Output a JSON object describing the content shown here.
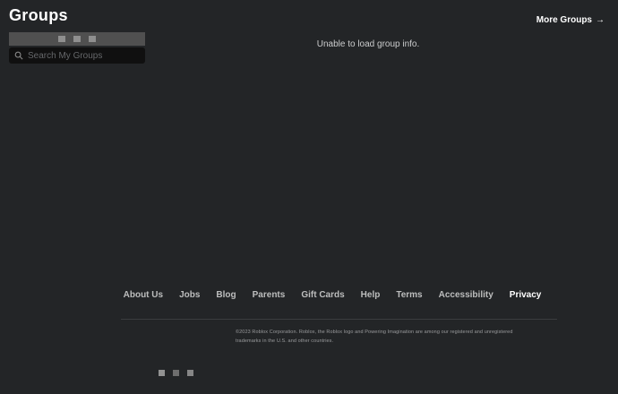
{
  "colors": {
    "bg": "#232527",
    "text-primary": "#ffffff",
    "text-secondary": "#bdbebe",
    "text-muted": "#9a9b9d",
    "tabstrip-bg": "#505050",
    "placeholder-square": "#8f8f8f",
    "searchbox-bg": "#101010",
    "search-placeholder": "#65676a",
    "divider": "#3b3d3f",
    "message": "#cbcccd",
    "social-sq-1": "#929292",
    "social-sq-2": "#6e6e6e",
    "social-sq-3": "#868686"
  },
  "header": {
    "title": "Groups",
    "more_groups_label": "More Groups",
    "more_groups_arrow": "→"
  },
  "sidebar": {
    "search_placeholder": "Search My Groups"
  },
  "main": {
    "error_message": "Unable to load group info."
  },
  "footer": {
    "links": [
      "About Us",
      "Jobs",
      "Blog",
      "Parents",
      "Gift Cards",
      "Help",
      "Terms",
      "Accessibility",
      "Privacy"
    ],
    "active_link": "Privacy",
    "copyright": "©2023 Roblox Corporation. Roblox, the Roblox logo and Powering Imagination are among our registered and unregistered trademarks in the U.S. and other countries."
  },
  "icons": {
    "search": "magnifier",
    "arrow_right": "→",
    "group_tab_placeholder": "square",
    "social_placeholder": "square"
  }
}
